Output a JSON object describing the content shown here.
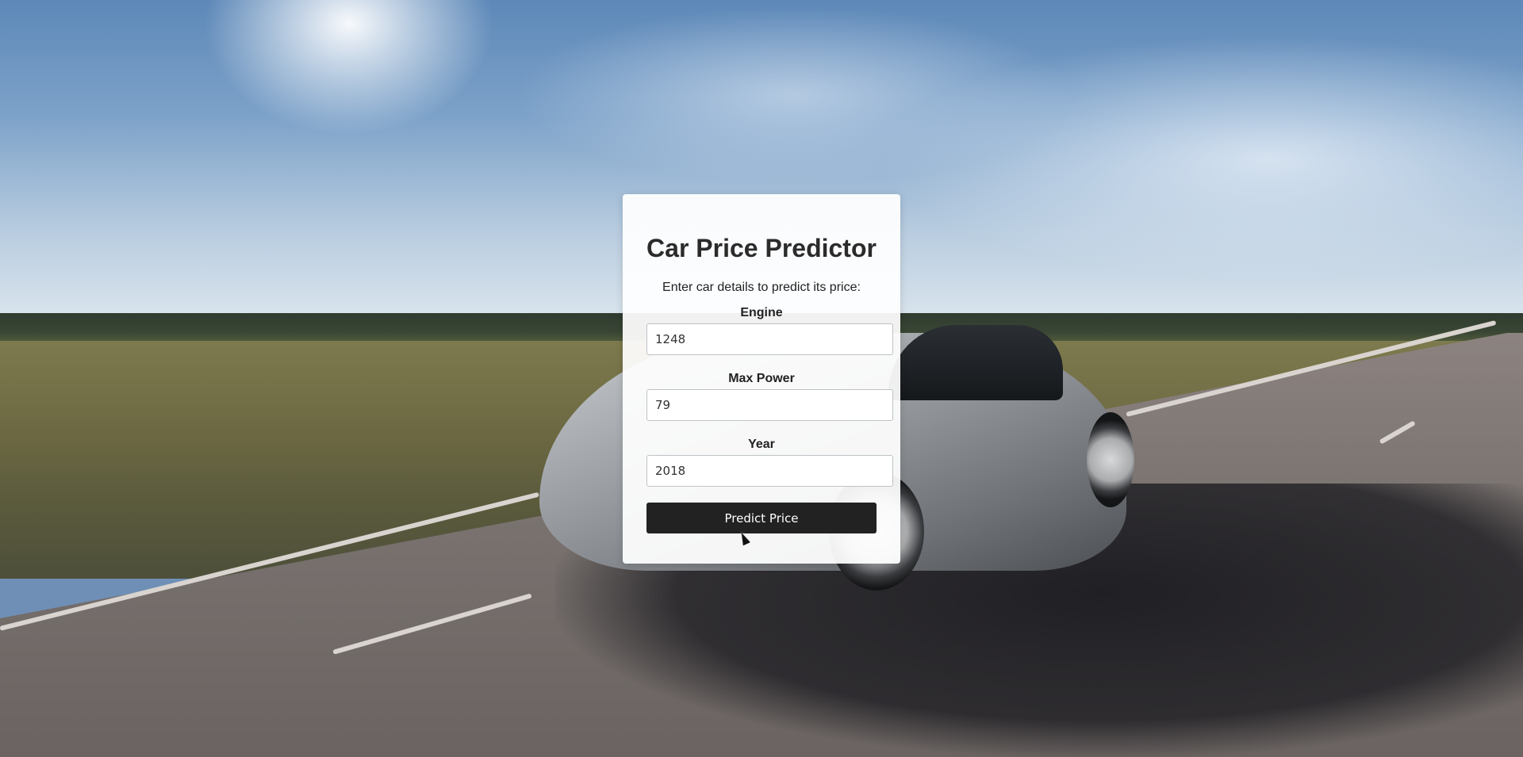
{
  "form": {
    "title": "Car Price Predictor",
    "subtitle": "Enter car details to predict its price:",
    "fields": [
      {
        "label": "Engine",
        "value": "1248"
      },
      {
        "label": "Max Power",
        "value": "79"
      },
      {
        "label": "Year",
        "value": "2018"
      }
    ],
    "submit_label": "Predict Price"
  }
}
